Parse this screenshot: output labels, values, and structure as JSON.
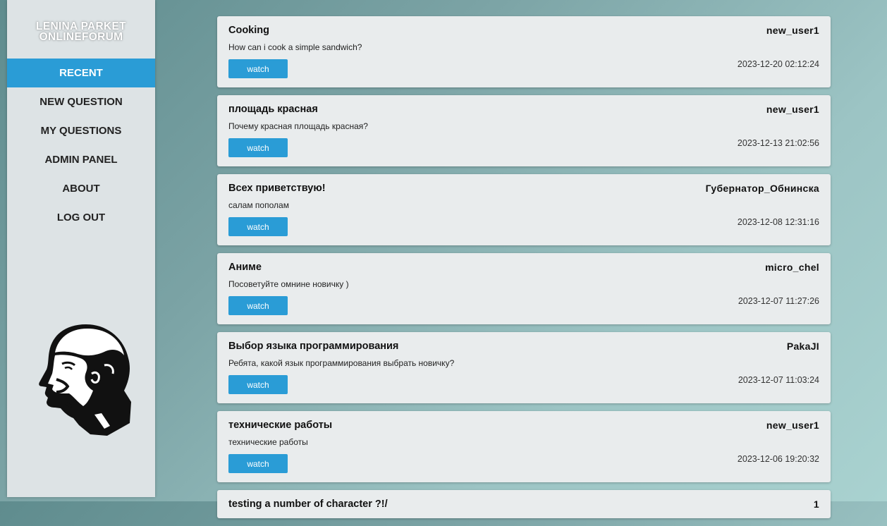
{
  "brand": {
    "line1": "LENINA PARKET",
    "line2": "ONLINEFORUM"
  },
  "nav": [
    {
      "label": "RECENT",
      "name": "nav-recent"
    },
    {
      "label": "NEW QUESTION",
      "name": "nav-new-question"
    },
    {
      "label": "MY QUESTIONS",
      "name": "nav-my-questions"
    },
    {
      "label": "ADMIN PANEL",
      "name": "nav-admin-panel"
    },
    {
      "label": "ABOUT",
      "name": "nav-about"
    },
    {
      "label": "LOG OUT",
      "name": "nav-log-out"
    }
  ],
  "active_nav": "RECENT",
  "watch_label": "watch",
  "posts": [
    {
      "title": "Cooking",
      "author": "new_user1",
      "text": "How can i cook a simple sandwich?",
      "date": "2023-12-20 02:12:24"
    },
    {
      "title": "площадь красная",
      "author": "new_user1",
      "text": "Почему красная площадь красная?",
      "date": "2023-12-13 21:02:56"
    },
    {
      "title": "Всех приветствую!",
      "author": "Губернатор_Обнинска",
      "text": "салам пополам",
      "date": "2023-12-08 12:31:16"
    },
    {
      "title": "Аниме",
      "author": "micro_chel",
      "text": "Посоветуйте омнине новичку )",
      "date": "2023-12-07 11:27:26"
    },
    {
      "title": "Выбор языка программирования",
      "author": "PakaJI",
      "text": "Ребята, какой язык программирования выбрать новичку?",
      "date": "2023-12-07 11:03:24"
    },
    {
      "title": "технические работы",
      "author": "new_user1",
      "text": "технические работы",
      "date": "2023-12-06 19:20:32"
    },
    {
      "title": "testing a number of character ?!/",
      "author": "1",
      "text": "",
      "date": ""
    }
  ],
  "colors": {
    "accent": "#2a9cd6",
    "sidebar": "#dde3e5",
    "card": "#e9eced"
  },
  "icons": {
    "portrait": "lenin-portrait-icon"
  }
}
